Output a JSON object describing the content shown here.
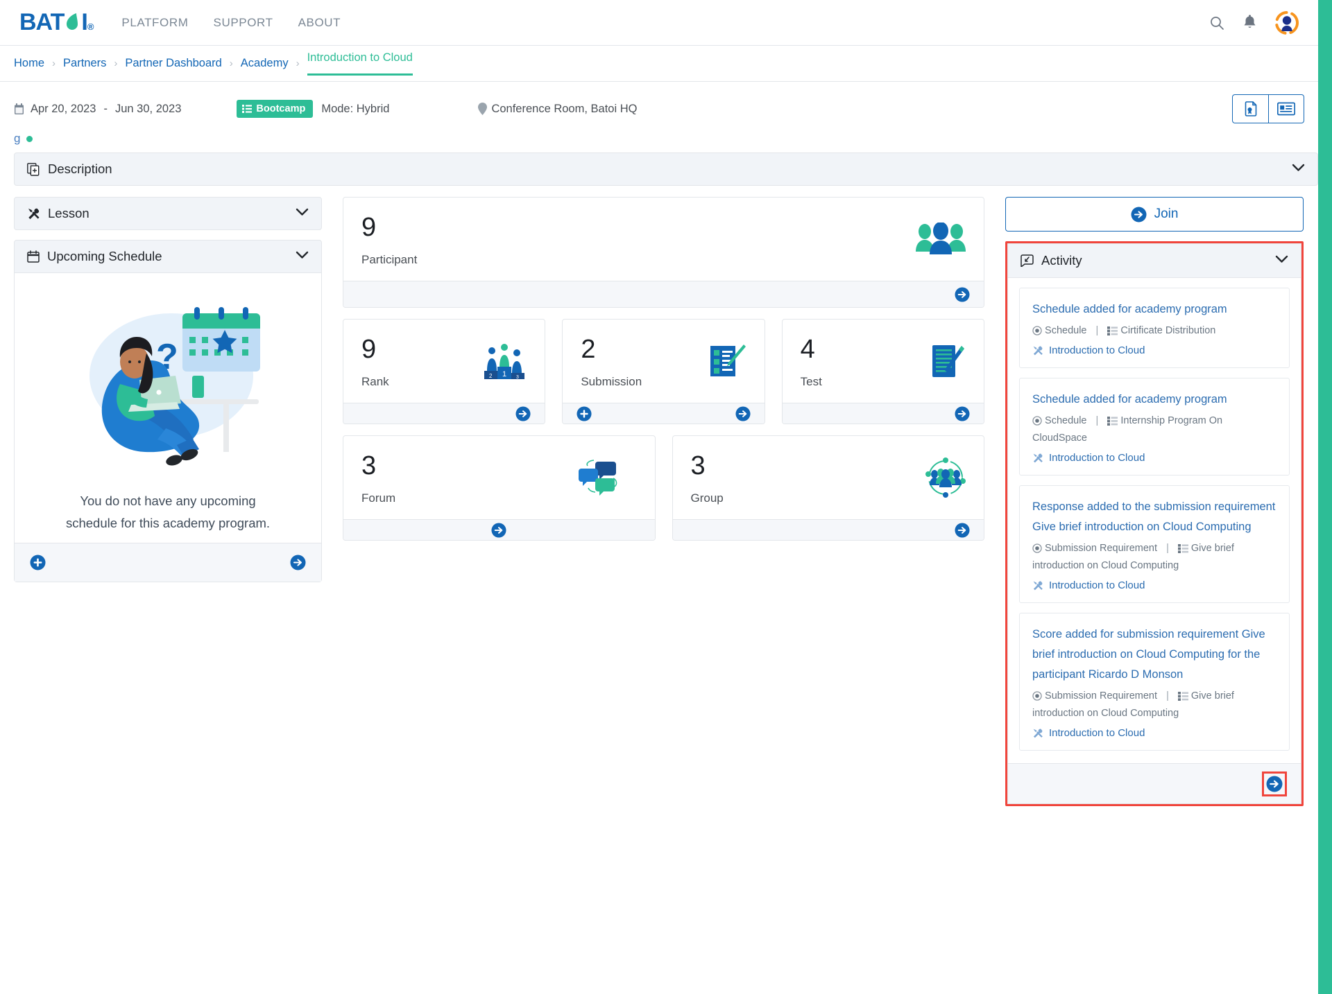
{
  "brand": {
    "name": "BATOI",
    "registered": "®",
    "accent": "#1266b5",
    "green": "#2dbd96"
  },
  "topnav": {
    "links": [
      {
        "label": "PLATFORM"
      },
      {
        "label": "SUPPORT"
      },
      {
        "label": "ABOUT"
      }
    ],
    "icons": [
      "search-icon",
      "bell-icon",
      "avatar-icon"
    ]
  },
  "breadcrumb": {
    "items": [
      {
        "label": "Home"
      },
      {
        "label": "Partners"
      },
      {
        "label": "Partner Dashboard"
      },
      {
        "label": "Academy"
      }
    ],
    "active": "Introduction to Cloud",
    "separator": "›"
  },
  "infobar": {
    "date_start": "Apr 20, 2023",
    "date_dash": "-",
    "date_end": "Jun 30, 2023",
    "badge": "Bootcamp",
    "mode": "Mode: Hybrid",
    "location": "Conference Room, Batoi HQ",
    "actions": [
      {
        "name": "certificate-button"
      },
      {
        "name": "id-card-button"
      }
    ]
  },
  "status_line": {
    "text": "g"
  },
  "description_panel": {
    "title": "Description"
  },
  "left_column": {
    "lesson_panel": {
      "title": "Lesson"
    },
    "schedule_panel": {
      "title": "Upcoming Schedule",
      "empty_message": "You do not have any upcoming schedule for this academy program."
    }
  },
  "stats": [
    {
      "value": "9",
      "label": "Participant",
      "icon": "group-people-icon",
      "has_add": false
    },
    {
      "value": "9",
      "label": "Rank",
      "icon": "podium-icon",
      "has_add": false
    },
    {
      "value": "2",
      "label": "Submission",
      "icon": "checklist-pen-icon",
      "has_add": true
    },
    {
      "value": "4",
      "label": "Test",
      "icon": "document-pen-icon",
      "has_add": false
    },
    {
      "value": "3",
      "label": "Forum",
      "icon": "chat-bubbles-icon",
      "has_add": false
    },
    {
      "value": "3",
      "label": "Group",
      "icon": "network-group-icon",
      "has_add": false
    }
  ],
  "right_column": {
    "join_label": "Join",
    "activity_panel": {
      "title": "Activity",
      "items": [
        {
          "title": "Schedule added for academy program",
          "type": "Schedule",
          "target": "Cirtificate Distribution",
          "program": "Introduction to Cloud"
        },
        {
          "title": "Schedule added for academy program",
          "type": "Schedule",
          "target": "Internship Program On CloudSpace",
          "program": "Introduction to Cloud"
        },
        {
          "title": "Response added to the submission requirement Give brief introduction on Cloud Computing",
          "type": "Submission Requirement",
          "target": "Give brief introduction on Cloud Computing",
          "program": "Introduction to Cloud"
        },
        {
          "title": "Score added for submission requirement Give brief introduction on Cloud Computing for the participant Ricardo D Monson",
          "type": "Submission Requirement",
          "target": "Give brief introduction on Cloud Computing",
          "program": "Introduction to Cloud"
        }
      ],
      "separator": "|"
    }
  }
}
